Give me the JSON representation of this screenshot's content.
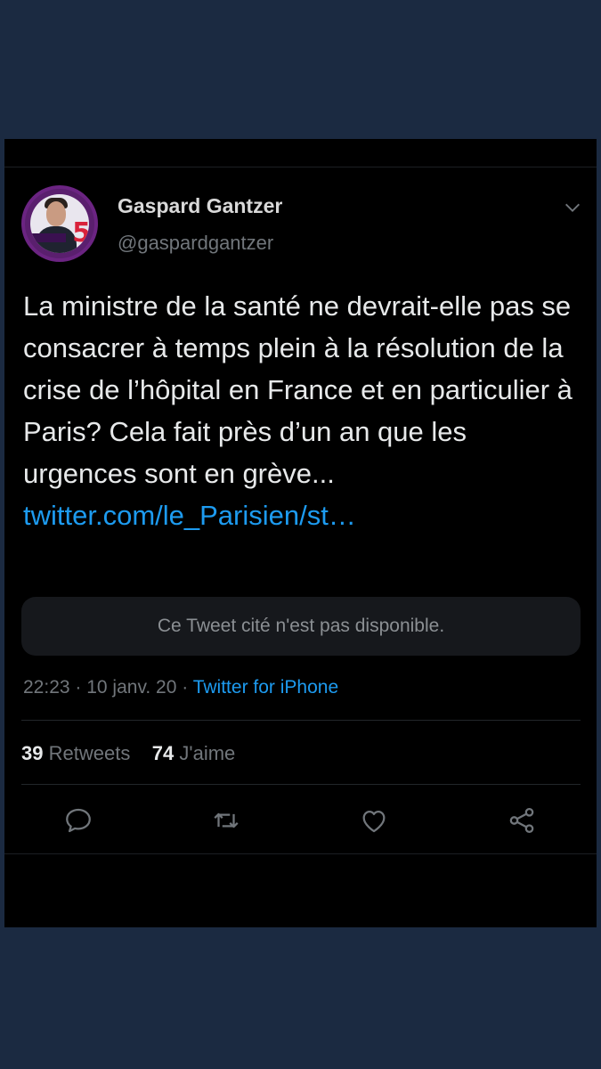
{
  "tweet": {
    "author_name": "Gaspard Gantzer",
    "author_handle": "@gaspardgantzer",
    "text": "La ministre de la santé ne devrait-elle pas se consacrer à temps plein à la résolution de la crise de l’hôpital en France et en particulier à Paris? Cela fait près d’un an que les urgences sont en grève... ",
    "link": "twitter.com/le_Parisien/st…",
    "quote_unavailable": "Ce Tweet cité n'est pas disponible.",
    "time": "22:23",
    "separator": " · ",
    "date": "10 janv. 20",
    "source": "Twitter for iPhone",
    "retweets_count": "39",
    "retweets_label": "Retweets",
    "likes_count": "74",
    "likes_label": "J'aime"
  },
  "icons": {
    "more": "chevron-down-icon",
    "reply": "reply-icon",
    "retweet": "retweet-icon",
    "like": "heart-icon",
    "share": "share-icon"
  },
  "colors": {
    "background": "#1b2a41",
    "card": "#000000",
    "link": "#1d9bf0",
    "text": "#e7e9ea",
    "muted": "#71767b"
  }
}
